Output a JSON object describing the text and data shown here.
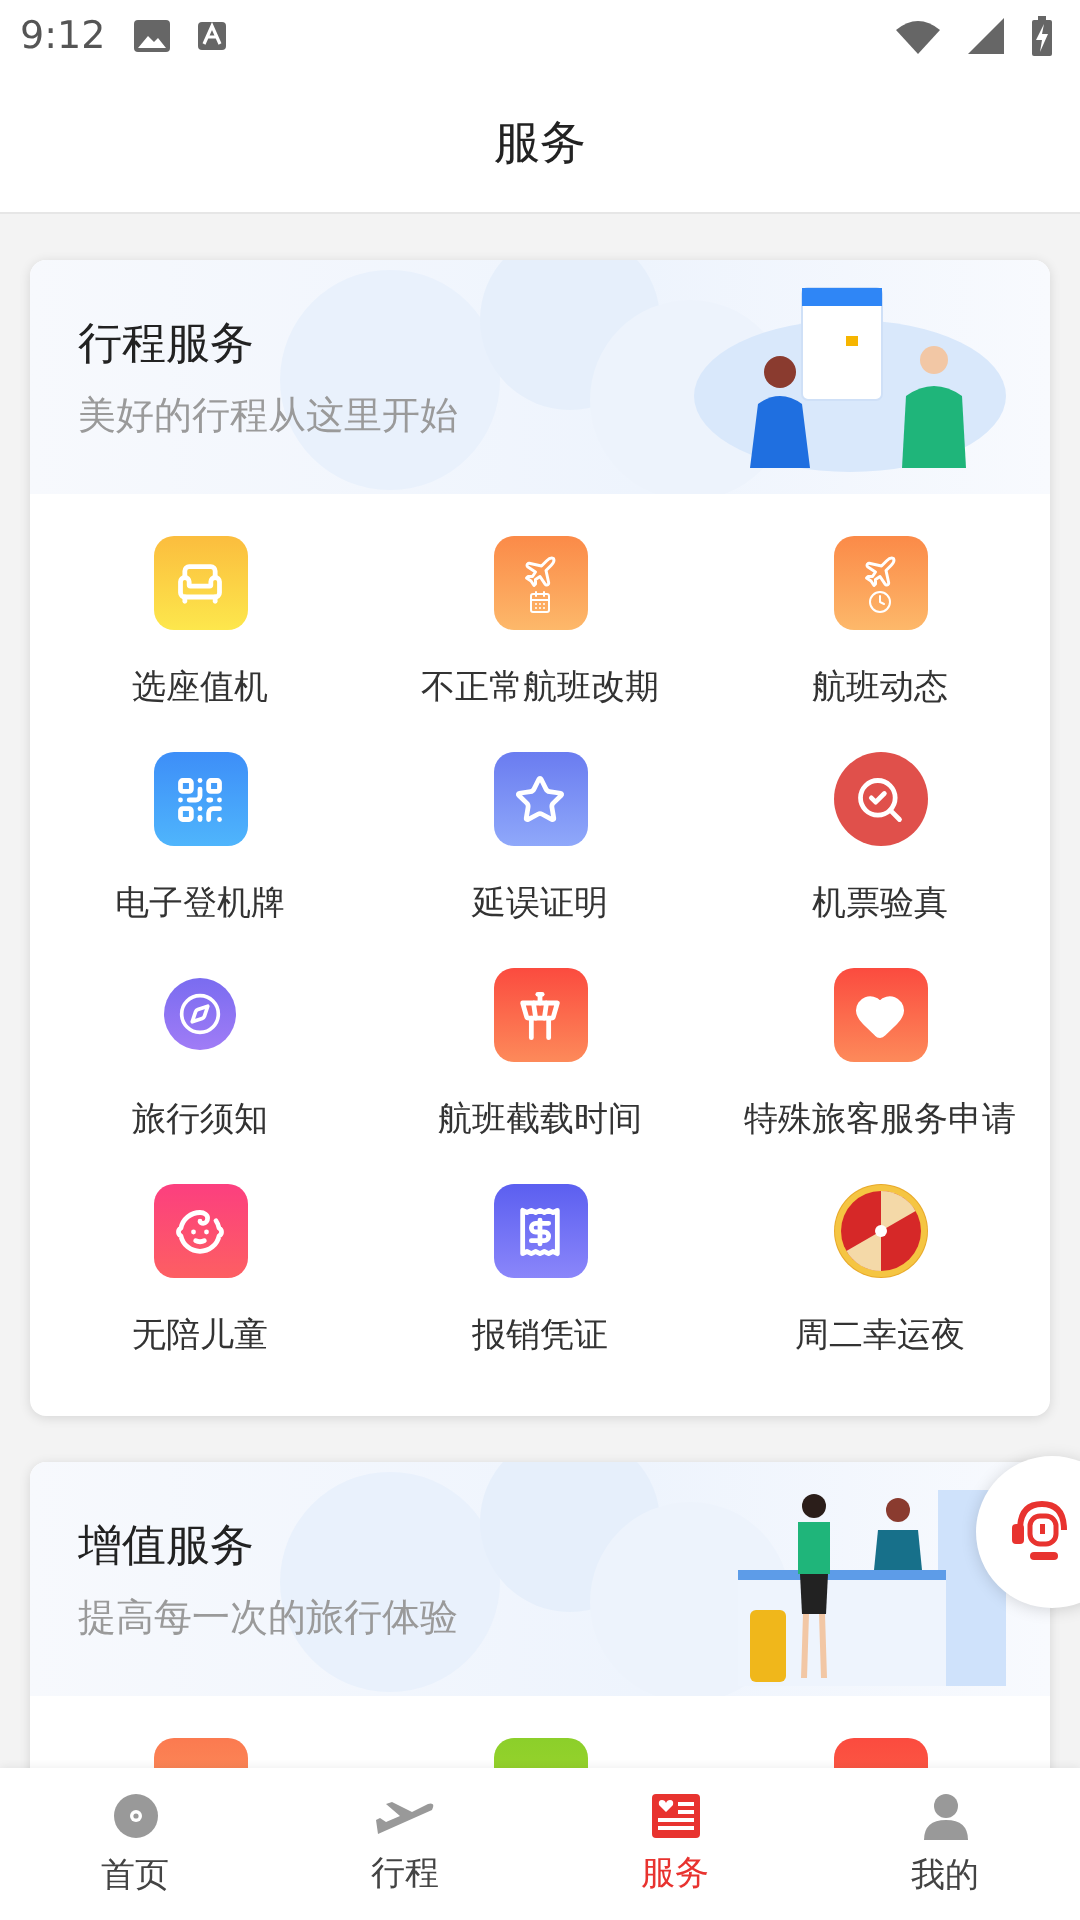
{
  "status_bar": {
    "time": "9:12"
  },
  "header": {
    "title": "服务"
  },
  "sections": [
    {
      "title": "行程服务",
      "subtitle": "美好的行程从这里开始",
      "items": [
        {
          "label": "选座值机"
        },
        {
          "label": "不正常航班改期"
        },
        {
          "label": "航班动态"
        },
        {
          "label": "电子登机牌"
        },
        {
          "label": "延误证明"
        },
        {
          "label": "机票验真"
        },
        {
          "label": "旅行须知"
        },
        {
          "label": "航班截载时间"
        },
        {
          "label": "特殊旅客服务申请"
        },
        {
          "label": "无陪儿童"
        },
        {
          "label": "报销凭证"
        },
        {
          "label": "周二幸运夜"
        }
      ]
    },
    {
      "title": "增值服务",
      "subtitle": "提高每一次的旅行体验"
    }
  ],
  "bottom_nav": [
    {
      "label": "首页",
      "selected": false
    },
    {
      "label": "行程",
      "selected": false
    },
    {
      "label": "服务",
      "selected": true
    },
    {
      "label": "我的",
      "selected": false
    }
  ]
}
